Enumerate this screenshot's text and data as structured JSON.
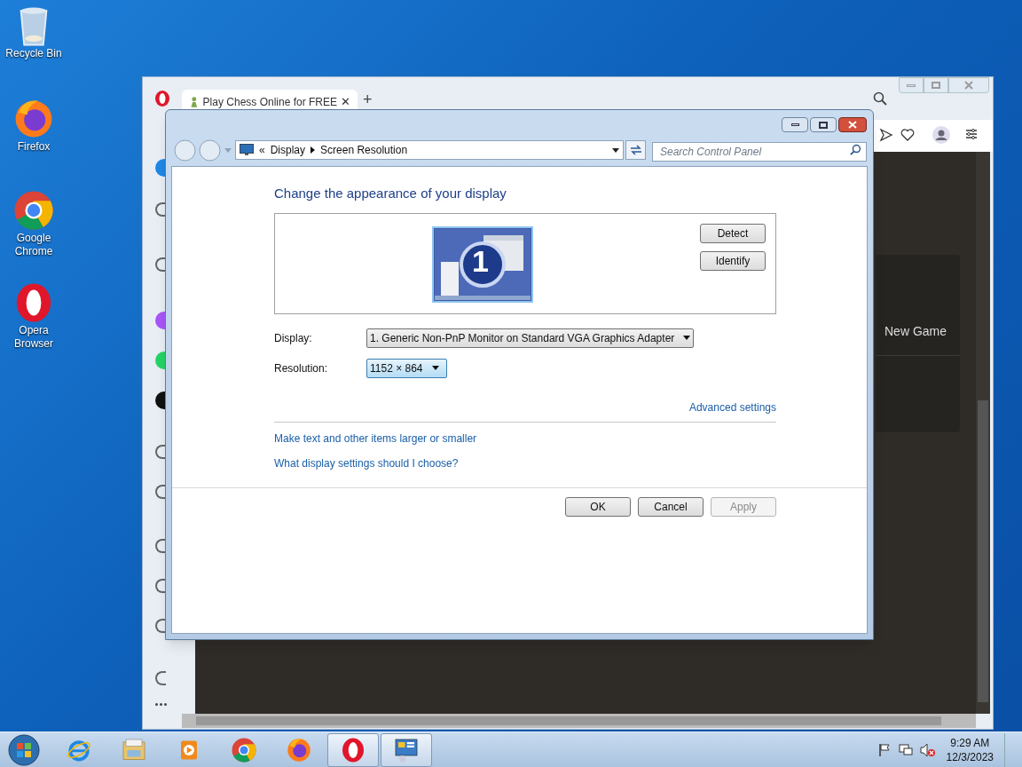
{
  "desktop_icons": [
    {
      "label": "Recycle Bin",
      "kind": "recycle"
    },
    {
      "label": "Firefox",
      "kind": "firefox"
    },
    {
      "label": "Google Chrome",
      "kind": "chrome"
    },
    {
      "label": "Opera Browser",
      "kind": "opera"
    }
  ],
  "browser": {
    "tab": {
      "title": "Play Chess Online for FREE",
      "close": "✕"
    },
    "new_tab": "+",
    "menu_item": "New Game"
  },
  "dialog": {
    "breadcrumb_overflow": "«",
    "breadcrumb": [
      {
        "label": "Display"
      },
      {
        "label": "Screen Resolution"
      }
    ],
    "search": {
      "placeholder": "Search Control Panel"
    },
    "heading": "Change the appearance of your display",
    "monitor_number": "1",
    "side_buttons": [
      "Detect",
      "Identify"
    ],
    "fields": [
      {
        "label": "Display:",
        "value": "1. Generic Non-PnP Monitor on Standard VGA Graphics Adapter",
        "focused": false
      },
      {
        "label": "Resolution:",
        "value": "1152 × 864",
        "focused": true
      }
    ],
    "advanced_link": "Advanced settings",
    "links": [
      "Make text and other items larger or smaller",
      "What display settings should I choose?"
    ],
    "buttons": [
      {
        "label": "OK",
        "disabled": false
      },
      {
        "label": "Cancel",
        "disabled": false
      },
      {
        "label": "Apply",
        "disabled": true
      }
    ]
  },
  "taskbar": {
    "apps": [
      {
        "kind": "ie",
        "running": false
      },
      {
        "kind": "explorer",
        "running": false
      },
      {
        "kind": "media",
        "running": false
      },
      {
        "kind": "chrome",
        "running": false
      },
      {
        "kind": "firefox",
        "running": false
      },
      {
        "kind": "opera",
        "running": true
      },
      {
        "kind": "control",
        "running": true
      }
    ],
    "clock": {
      "time": "9:29 AM",
      "date": "12/3/2023"
    }
  }
}
